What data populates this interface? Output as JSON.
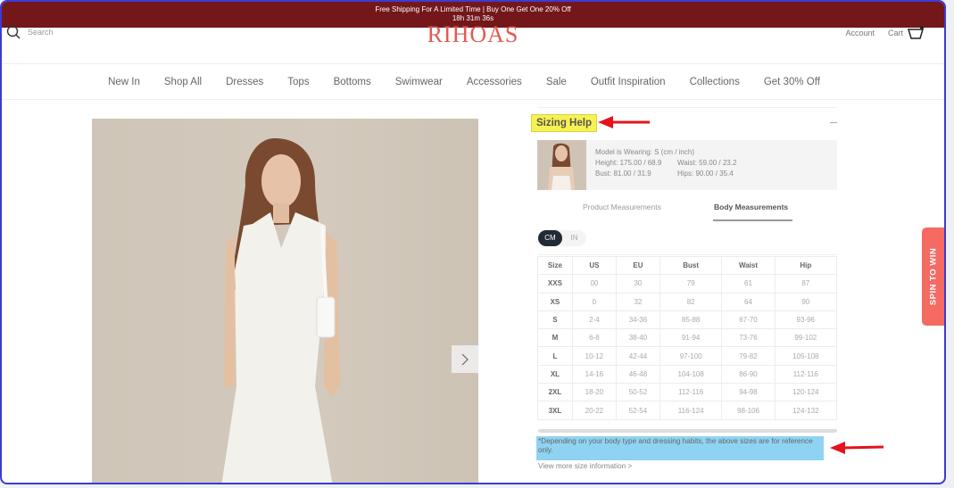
{
  "announcement": {
    "line1": "Free Shipping For A Limited Time | Buy One Get One 20% Off",
    "countdown": "18h 31m 36s"
  },
  "header": {
    "search_label": "Search",
    "logo": "RIHOAS",
    "account_label": "Account",
    "cart_label": "Cart"
  },
  "nav": {
    "items": [
      "New In",
      "Shop All",
      "Dresses",
      "Tops",
      "Bottoms",
      "Swimwear",
      "Accessories",
      "Sale",
      "Outfit Inspiration",
      "Collections",
      "Get 30% Off"
    ]
  },
  "colors": {
    "announcement_bg": "#73171b",
    "logo": "#e45a52",
    "highlight_yellow": "#f6f251",
    "highlight_blue": "#8fd3f2",
    "annotation_arrow": "#e3141b",
    "spin_bg": "#f56a62",
    "unit_active_bg": "#222a35"
  },
  "sizing": {
    "title": "Sizing Help",
    "model": {
      "wearing": "Model is Wearing: S (cm / inch)",
      "height": "Height: 175.00 / 68.9",
      "waist": "Waist: 59.00 / 23.2",
      "bust": "Bust: 81.00 / 31.9",
      "hips": "Hips: 90.00 / 35.4"
    },
    "tabs": {
      "product": "Product Measurements",
      "body": "Body Measurements",
      "active": "body"
    },
    "units": {
      "cm": "CM",
      "in": "IN",
      "active": "CM"
    },
    "table": {
      "headers": [
        "Size",
        "US",
        "EU",
        "Bust",
        "Waist",
        "Hip"
      ],
      "rows": [
        [
          "XXS",
          "00",
          "30",
          "79",
          "61",
          "87"
        ],
        [
          "XS",
          "0",
          "32",
          "82",
          "64",
          "90"
        ],
        [
          "S",
          "2-4",
          "34-36",
          "85-88",
          "67-70",
          "93-96"
        ],
        [
          "M",
          "6-8",
          "38-40",
          "91-94",
          "73-76",
          "99-102"
        ],
        [
          "L",
          "10-12",
          "42-44",
          "97-100",
          "79-82",
          "105-108"
        ],
        [
          "XL",
          "14-16",
          "46-48",
          "104-108",
          "86-90",
          "112-116"
        ],
        [
          "2XL",
          "18-20",
          "50-52",
          "112-116",
          "94-98",
          "120-124"
        ],
        [
          "3XL",
          "20-22",
          "52-54",
          "116-124",
          "98-106",
          "124-132"
        ]
      ]
    },
    "note": "*Depending on your body type and dressing habits, the above sizes are for reference only.",
    "more_link": "View more size information >"
  },
  "spin": {
    "label": "SPIN TO WIN"
  }
}
